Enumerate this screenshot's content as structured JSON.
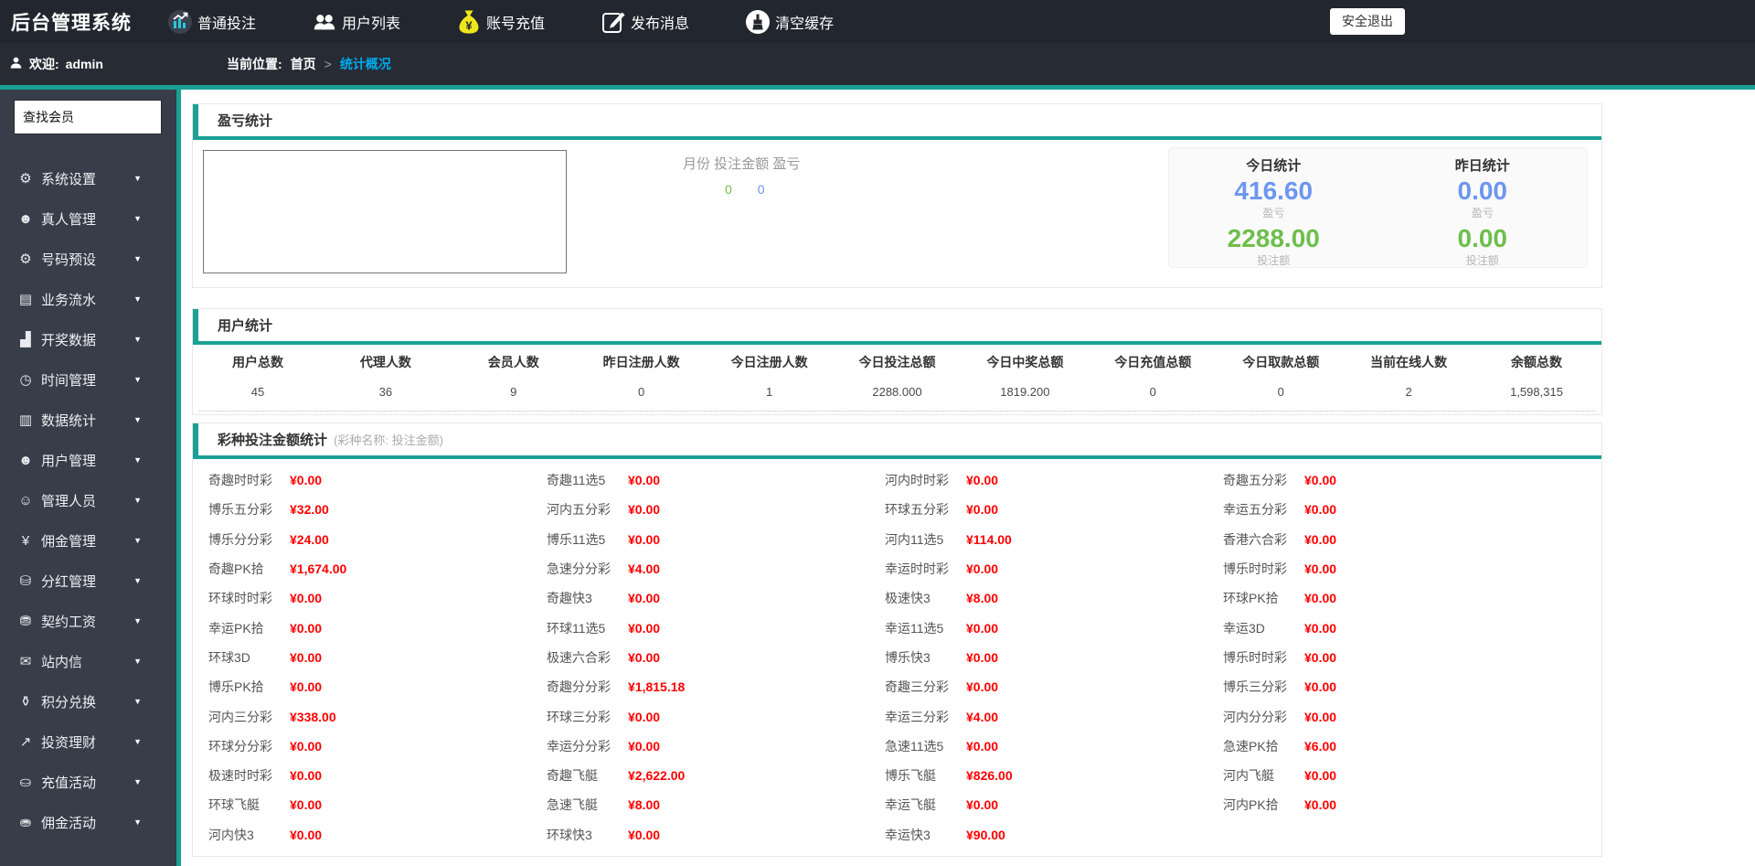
{
  "topbar": {
    "title": "后台管理系统",
    "nav": [
      {
        "label": "普通投注",
        "icon": "bar-chart-circle-icon"
      },
      {
        "label": "用户列表",
        "icon": "users-icon"
      },
      {
        "label": "账号充值",
        "icon": "money-bag-icon"
      },
      {
        "label": "发布消息",
        "icon": "compose-icon"
      },
      {
        "label": "清空缓存",
        "icon": "clean-brush-icon"
      }
    ],
    "logout_label": "安全退出"
  },
  "userbar": {
    "welcome_label": "欢迎:",
    "username": "admin",
    "breadcrumb_label": "当前位置:",
    "breadcrumb_home": "首页",
    "breadcrumb_separator": ">",
    "breadcrumb_current": "统计概况"
  },
  "sidebar": {
    "search_value": "查找会员",
    "items": [
      {
        "label": "系统设置",
        "icon": "gear-icon",
        "glyph": "⚙"
      },
      {
        "label": "真人管理",
        "icon": "person-icon",
        "glyph": "☻"
      },
      {
        "label": "号码预设",
        "icon": "gear-outline-icon",
        "glyph": "⚙"
      },
      {
        "label": "业务流水",
        "icon": "ledger-icon",
        "glyph": "▤"
      },
      {
        "label": "开奖数据",
        "icon": "bar-chart-icon",
        "glyph": "▟"
      },
      {
        "label": "时间管理",
        "icon": "clock-icon",
        "glyph": "◷"
      },
      {
        "label": "数据统计",
        "icon": "stats-chart-icon",
        "glyph": "▥"
      },
      {
        "label": "用户管理",
        "icon": "users-group-icon",
        "glyph": "☻"
      },
      {
        "label": "管理人员",
        "icon": "admin-person-icon",
        "glyph": "☺"
      },
      {
        "label": "佣金管理",
        "icon": "yen-circle-icon",
        "glyph": "¥"
      },
      {
        "label": "分红管理",
        "icon": "coins-icon",
        "glyph": "⛁"
      },
      {
        "label": "契约工资",
        "icon": "coins-stack-icon",
        "glyph": "⛃"
      },
      {
        "label": "站内信",
        "icon": "mail-icon",
        "glyph": "✉"
      },
      {
        "label": "积分兑换",
        "icon": "points-bag-icon",
        "glyph": "⚱"
      },
      {
        "label": "投资理财",
        "icon": "trend-box-icon",
        "glyph": "↗"
      },
      {
        "label": "充值活动",
        "icon": "recharge-icon",
        "glyph": "⛀"
      },
      {
        "label": "佣金活动",
        "icon": "commission-icon",
        "glyph": "⛂"
      }
    ]
  },
  "profit_section": {
    "title": "盈亏统计",
    "legend_text": "月份 投注金额 盈亏",
    "legend_value_green": "0",
    "legend_value_blue": "0",
    "today": {
      "title": "今日统计",
      "profit": "416.60",
      "profit_label": "盈亏",
      "bet": "2288.00",
      "bet_label": "投注额"
    },
    "yesterday": {
      "title": "昨日统计",
      "profit": "0.00",
      "profit_label": "盈亏",
      "bet": "0.00",
      "bet_label": "投注额"
    }
  },
  "user_stats": {
    "title": "用户统计",
    "columns": [
      "用户总数",
      "代理人数",
      "会员人数",
      "昨日注册人数",
      "今日注册人数",
      "今日投注总额",
      "今日中奖总额",
      "今日充值总额",
      "今日取款总额",
      "当前在线人数",
      "余额总数"
    ],
    "values": [
      "45",
      "36",
      "9",
      "0",
      "1",
      "2288.000",
      "1819.200",
      "0",
      "0",
      "2",
      "1,598,315"
    ]
  },
  "lottery_section": {
    "title": "彩种投注金额统计",
    "subtitle": "(彩种名称: 投注金额)",
    "columns": [
      [
        {
          "name": "奇趣时时彩",
          "amount": "¥0.00"
        },
        {
          "name": "博乐五分彩",
          "amount": "¥32.00"
        },
        {
          "name": "博乐分分彩",
          "amount": "¥24.00"
        },
        {
          "name": "奇趣PK拾",
          "amount": "¥1,674.00"
        },
        {
          "name": "环球时时彩",
          "amount": "¥0.00"
        },
        {
          "name": "幸运PK拾",
          "amount": "¥0.00"
        },
        {
          "name": "环球3D",
          "amount": "¥0.00"
        },
        {
          "name": "博乐PK拾",
          "amount": "¥0.00"
        },
        {
          "name": "河内三分彩",
          "amount": "¥338.00"
        },
        {
          "name": "环球分分彩",
          "amount": "¥0.00"
        },
        {
          "name": "极速时时彩",
          "amount": "¥0.00"
        },
        {
          "name": "环球飞艇",
          "amount": "¥0.00"
        },
        {
          "name": "河内快3",
          "amount": "¥0.00"
        }
      ],
      [
        {
          "name": "奇趣11选5",
          "amount": "¥0.00"
        },
        {
          "name": "河内五分彩",
          "amount": "¥0.00"
        },
        {
          "name": "博乐11选5",
          "amount": "¥0.00"
        },
        {
          "name": "急速分分彩",
          "amount": "¥4.00"
        },
        {
          "name": "奇趣快3",
          "amount": "¥0.00"
        },
        {
          "name": "环球11选5",
          "amount": "¥0.00"
        },
        {
          "name": "极速六合彩",
          "amount": "¥0.00"
        },
        {
          "name": "奇趣分分彩",
          "amount": "¥1,815.18"
        },
        {
          "name": "环球三分彩",
          "amount": "¥0.00"
        },
        {
          "name": "幸运分分彩",
          "amount": "¥0.00"
        },
        {
          "name": "奇趣飞艇",
          "amount": "¥2,622.00"
        },
        {
          "name": "急速飞艇",
          "amount": "¥8.00"
        },
        {
          "name": "环球快3",
          "amount": "¥0.00"
        }
      ],
      [
        {
          "name": "河内时时彩",
          "amount": "¥0.00"
        },
        {
          "name": "环球五分彩",
          "amount": "¥0.00"
        },
        {
          "name": "河内11选5",
          "amount": "¥114.00"
        },
        {
          "name": "幸运时时彩",
          "amount": "¥0.00"
        },
        {
          "name": "极速快3",
          "amount": "¥8.00"
        },
        {
          "name": "幸运11选5",
          "amount": "¥0.00"
        },
        {
          "name": "博乐快3",
          "amount": "¥0.00"
        },
        {
          "name": "奇趣三分彩",
          "amount": "¥0.00"
        },
        {
          "name": "幸运三分彩",
          "amount": "¥4.00"
        },
        {
          "name": "急速11选5",
          "amount": "¥0.00"
        },
        {
          "name": "博乐飞艇",
          "amount": "¥826.00"
        },
        {
          "name": "幸运飞艇",
          "amount": "¥0.00"
        },
        {
          "name": "幸运快3",
          "amount": "¥90.00"
        }
      ],
      [
        {
          "name": "奇趣五分彩",
          "amount": "¥0.00"
        },
        {
          "name": "幸运五分彩",
          "amount": "¥0.00"
        },
        {
          "name": "香港六合彩",
          "amount": "¥0.00"
        },
        {
          "name": "博乐时时彩",
          "amount": "¥0.00"
        },
        {
          "name": "环球PK拾",
          "amount": "¥0.00"
        },
        {
          "name": "幸运3D",
          "amount": "¥0.00"
        },
        {
          "name": "博乐时时彩",
          "amount": "¥0.00"
        },
        {
          "name": "博乐三分彩",
          "amount": "¥0.00"
        },
        {
          "name": "河内分分彩",
          "amount": "¥0.00"
        },
        {
          "name": "急速PK拾",
          "amount": "¥6.00"
        },
        {
          "name": "河内飞艇",
          "amount": "¥0.00"
        },
        {
          "name": "河内PK拾",
          "amount": "¥0.00"
        }
      ]
    ]
  },
  "colors": {
    "teal_accent": "#1aa094",
    "topbar_bg": "#22262e",
    "userbar_bg": "#262b34",
    "sidebar_bg": "#373d49",
    "breadcrumb_active": "#01aaed",
    "amount_red": "#ff0000",
    "profit_blue": "#6d96f0",
    "bet_green": "#6ebe4c"
  }
}
